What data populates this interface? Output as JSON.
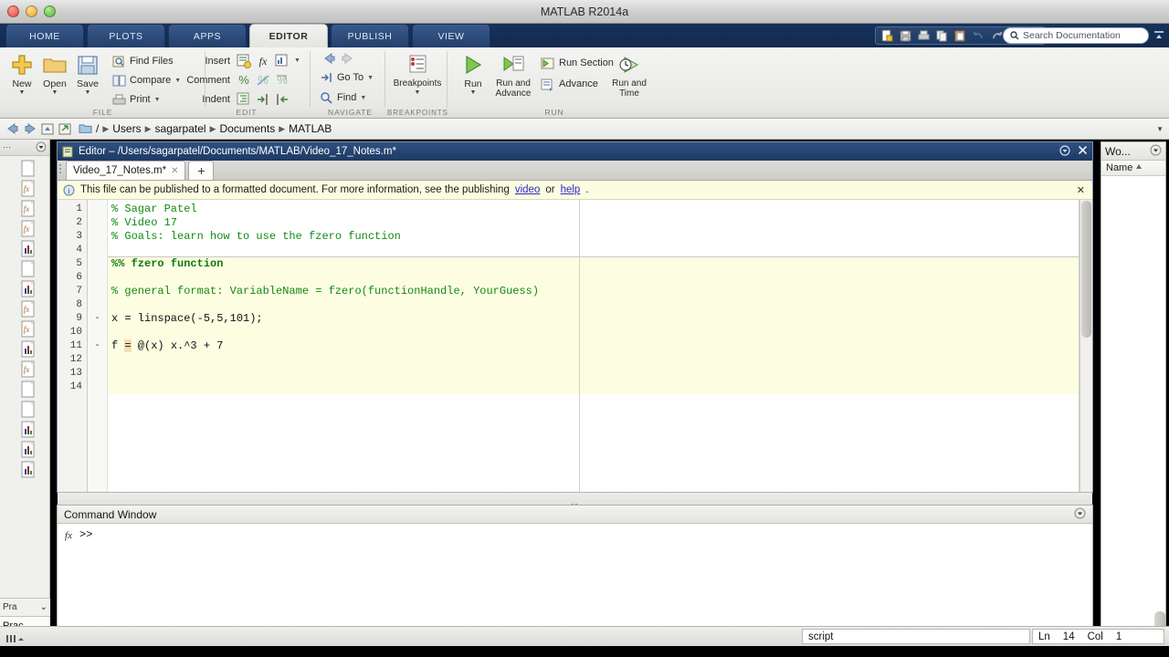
{
  "window": {
    "title": "MATLAB R2014a"
  },
  "ribbon_tabs": [
    {
      "label": "HOME",
      "active": false
    },
    {
      "label": "PLOTS",
      "active": false
    },
    {
      "label": "APPS",
      "active": false
    },
    {
      "label": "EDITOR",
      "active": true
    },
    {
      "label": "PUBLISH",
      "active": false
    },
    {
      "label": "VIEW",
      "active": false
    }
  ],
  "quick_access": {
    "icons": [
      "new-script-icon",
      "save-icon",
      "print-icon",
      "copy-icon",
      "paste-icon",
      "undo-icon",
      "redo-icon",
      "switch-window-icon",
      "help-icon"
    ],
    "search": {
      "placeholder": "Search Documentation",
      "icon": "search-icon"
    },
    "collapse_icon": "collapse-ribbon-icon"
  },
  "ribbon_groups": {
    "file": {
      "label": "FILE",
      "big": [
        {
          "label": "New",
          "icon": "new-plus-icon",
          "has_caret": true
        },
        {
          "label": "Open",
          "icon": "folder-open-icon",
          "has_caret": true
        },
        {
          "label": "Save",
          "icon": "save-disk-icon",
          "has_caret": true
        }
      ],
      "small": [
        {
          "label": "Find Files",
          "icon": "find-files-icon",
          "has_caret": false
        },
        {
          "label": "Compare",
          "icon": "compare-icon",
          "has_caret": true
        },
        {
          "label": "Print",
          "icon": "print-icon",
          "has_caret": true
        }
      ]
    },
    "edit": {
      "label": "EDIT",
      "rows": [
        {
          "label": "Insert",
          "icons": [
            "insert-text-icon",
            "insert-function-icon",
            "insert-data-icon"
          ],
          "has_caret": true
        },
        {
          "label": "Comment",
          "icons": [
            "comment-icon",
            "uncomment-icon",
            "wrap-comment-icon"
          ],
          "has_caret": false
        },
        {
          "label": "Indent",
          "icons": [
            "smart-indent-icon",
            "indent-right-icon",
            "indent-left-icon"
          ],
          "has_caret": false
        }
      ]
    },
    "navigate": {
      "label": "NAVIGATE",
      "top_icons": [
        "back-arrow-icon",
        "forward-arrow-icon"
      ],
      "items": [
        {
          "label": "Go To",
          "icon": "go-to-icon",
          "has_caret": true
        },
        {
          "label": "Find",
          "icon": "find-magnifier-icon",
          "has_caret": true
        }
      ]
    },
    "breakpoints": {
      "label": "BREAKPOINTS",
      "big": [
        {
          "label": "Breakpoints",
          "icon": "breakpoints-icon",
          "has_caret": true
        }
      ]
    },
    "run": {
      "label": "RUN",
      "big": [
        {
          "label": "Run",
          "icon": "run-play-icon",
          "has_caret": true
        },
        {
          "label": "Run and\nAdvance",
          "icon": "run-advance-icon",
          "has_caret": false
        },
        {
          "label": "Run and\nTime",
          "icon": "run-time-icon",
          "has_caret": false
        }
      ],
      "small": [
        {
          "label": "Run Section",
          "icon": "run-section-icon"
        },
        {
          "label": "Advance",
          "icon": "advance-icon"
        }
      ]
    }
  },
  "breadcrumb": {
    "back_icon": "back-arrow-icon",
    "forward_icon": "forward-arrow-icon",
    "up_icon": "up-folder-icon",
    "browse_icon": "browse-folder-icon",
    "folder_icon": "folder-icon",
    "root": "/",
    "path": [
      "Users",
      "sagarpatel",
      "Documents",
      "MATLAB"
    ],
    "dropdown_icon": "chevron-down-icon"
  },
  "left_panel": {
    "header_icon": "panel-menu-icon",
    "collapsed_label_top": "Pra",
    "collapsed_label_bottom": "Prac",
    "file_icons": [
      "file-blank-icon",
      "function-fx-icon",
      "function-fx-icon",
      "function-fx-icon",
      "figure-chart-icon",
      "file-blank-icon",
      "figure-chart-icon",
      "function-fx-icon",
      "function-fx-icon",
      "figure-chart-icon",
      "function-fx-icon",
      "file-blank-icon",
      "file-blank-icon",
      "figure-chart-icon",
      "figure-chart-icon",
      "figure-chart-icon"
    ],
    "dropdown_icon": "chevron-down-icon"
  },
  "editor": {
    "title": "Editor – /Users/sagarpatel/Documents/MATLAB/Video_17_Notes.m*",
    "title_icon": "editor-doc-icon",
    "undock_icon": "undock-icon",
    "close_icon": "close-icon",
    "tab": {
      "label": "Video_17_Notes.m*",
      "close_icon": "close-tab-icon"
    },
    "new_tab_label": "+",
    "notice": {
      "icon": "info-icon",
      "text_before": "This file can be published to a formatted document. For more information, see the publishing ",
      "link_video": "video",
      "text_middle": " or ",
      "link_help": "help",
      "text_after": ".",
      "close_icon": "close-notice-icon"
    },
    "lines": [
      {
        "n": "1",
        "bp": "",
        "text": "% Sagar Patel",
        "style": "comment",
        "section": false
      },
      {
        "n": "2",
        "bp": "",
        "text": "% Video 17",
        "style": "comment",
        "section": false
      },
      {
        "n": "3",
        "bp": "",
        "text": "% Goals: learn how to use the fzero function",
        "style": "comment",
        "section": false
      },
      {
        "n": "4",
        "bp": "",
        "text": "",
        "style": "plain",
        "section": false
      },
      {
        "n": "5",
        "bp": "",
        "text": "%% fzero function",
        "style": "section-header",
        "section": true
      },
      {
        "n": "6",
        "bp": "",
        "text": "",
        "style": "plain",
        "section": true
      },
      {
        "n": "7",
        "bp": "",
        "text": "% general format: VariableName = fzero(functionHandle, YourGuess)",
        "style": "comment",
        "section": true
      },
      {
        "n": "8",
        "bp": "",
        "text": "",
        "style": "plain",
        "section": true
      },
      {
        "n": "9",
        "bp": "-",
        "text": "x = linspace(-5,5,101);",
        "style": "code",
        "section": true
      },
      {
        "n": "10",
        "bp": "",
        "text": "",
        "style": "plain",
        "section": true
      },
      {
        "n": "11",
        "bp": "-",
        "text": "f = @(x) x.^3 + 7",
        "style": "code-marked",
        "section": true
      },
      {
        "n": "12",
        "bp": "",
        "text": "",
        "style": "plain",
        "section": true
      },
      {
        "n": "13",
        "bp": "",
        "text": "",
        "style": "plain",
        "section": true
      },
      {
        "n": "14",
        "bp": "",
        "text": "",
        "style": "plain",
        "section": true
      }
    ],
    "analyzer_marker": "warning-marker"
  },
  "command_window": {
    "title": "Command Window",
    "dropdown_icon": "chevron-down-icon",
    "fx_icon": "fx-icon",
    "prompt": ">>"
  },
  "workspace": {
    "title": "Wo...",
    "dropdown_icon": "chevron-down-icon",
    "column": "Name",
    "sort_icon": "sort-ascending-icon"
  },
  "status_bar": {
    "file_type": "script",
    "line_label": "Ln",
    "line_value": "14",
    "col_label": "Col",
    "col_value": "1"
  },
  "colors": {
    "ribbon_blue": "#16325c",
    "section_yellow": "#fdfde2",
    "comment_green": "#128a12",
    "link_blue": "#2a2ad0",
    "marker_orange": "#e89a22"
  }
}
